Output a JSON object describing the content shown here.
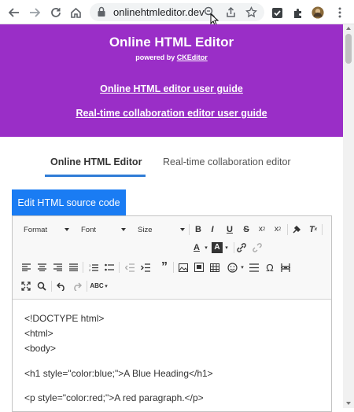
{
  "browser": {
    "url": "onlinehtmleditor.dev"
  },
  "header": {
    "title": "Online HTML Editor",
    "powered_prefix": "powered by ",
    "powered_brand": "CKEditor",
    "guide_link": "Online HTML editor user guide",
    "collab_link": "Real-time collaboration editor user guide",
    "bg_color": "#9a2ec7"
  },
  "tabs": [
    {
      "label": "Online HTML Editor",
      "active": true
    },
    {
      "label": "Real-time collaboration editor",
      "active": false
    }
  ],
  "edit_button": {
    "label": "Edit HTML source code",
    "color": "#1a7cf3"
  },
  "toolbar": {
    "format": "Format",
    "font": "Font",
    "size": "Size"
  },
  "code_lines": [
    "<!DOCTYPE html>",
    "<html>",
    "<body>",
    "<h1 style=\"color:blue;\">A Blue Heading</h1>",
    "<p style=\"color:red;\">A red paragraph.</p>"
  ]
}
